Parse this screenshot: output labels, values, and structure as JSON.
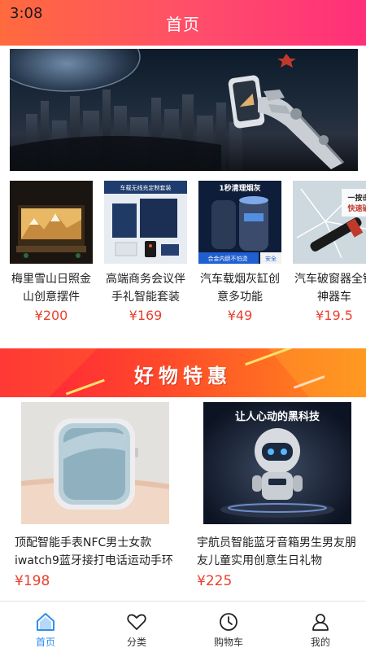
{
  "status": {
    "time": "3:08"
  },
  "header": {
    "title": "首页"
  },
  "featured": [
    {
      "name": "梅里雪山日照金山创意摆件",
      "price": "¥200"
    },
    {
      "name": "高端商务会议伴手礼智能套装",
      "price": "¥169"
    },
    {
      "name": "汽车载烟灰缸创意多功能",
      "price": "¥49"
    },
    {
      "name": "汽车破窗器全锤神器车",
      "price": "¥19.5"
    }
  ],
  "featured_image_text": {
    "item2": "车载无线充定制套装",
    "item3_top": "1秒清理烟灰",
    "item3_bottom": "合金内胆不怕烫",
    "item3_badge": "安全",
    "item4_top": "一按击",
    "item4_bottom": "快速破"
  },
  "promo": {
    "title": "好物特惠"
  },
  "products": [
    {
      "name": "顶配智能手表NFC男士女款iwatch9蓝牙接打电话运动手环",
      "price": "¥198"
    },
    {
      "name": "宇航员智能蓝牙音箱男生男友朋友儿童实用创意生日礼物",
      "price": "¥225",
      "image_caption": "让人心动的黑科技"
    }
  ],
  "tabs": [
    {
      "label": "首页",
      "icon": "home-icon",
      "active": true
    },
    {
      "label": "分类",
      "icon": "heart-icon",
      "active": false
    },
    {
      "label": "购物车",
      "icon": "clock-icon",
      "active": false
    },
    {
      "label": "我的",
      "icon": "user-icon",
      "active": false
    }
  ],
  "colors": {
    "accent": "#2f8ef0",
    "price": "#e8412f",
    "header_start": "#ff6a3d",
    "header_end": "#ff2f7a"
  }
}
